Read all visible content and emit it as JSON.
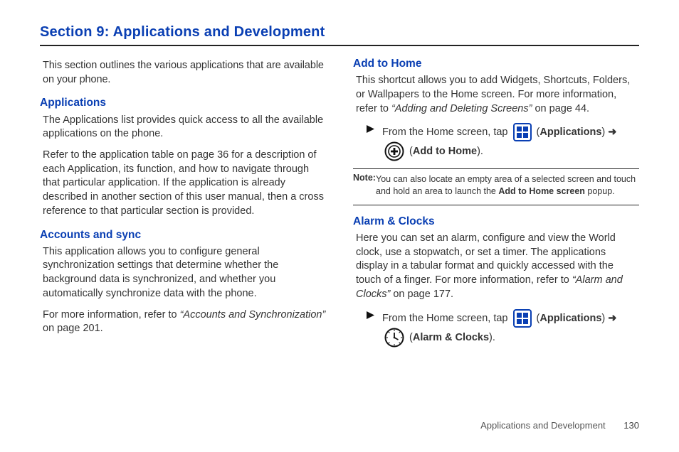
{
  "title": "Section 9: Applications and Development",
  "left": {
    "intro": "This section outlines the various applications that are available on your phone.",
    "h_applications": "Applications",
    "applications_p1": "The Applications list provides quick access to all the available applications on the phone.",
    "applications_p2": "Refer to the application table on page 36 for a description of each Application, its function, and how to navigate through that particular application. If the application is already described in another section of this user manual, then a cross reference to that particular section is provided.",
    "h_accounts": "Accounts and sync",
    "accounts_p1": "This application allows you to configure general synchronization settings that determine whether the background data is synchronized, and whether you automatically synchronize data with the phone.",
    "accounts_p2a": "For more information, refer to ",
    "accounts_p2b": "“Accounts and Synchronization”",
    "accounts_p2c": " on page 201."
  },
  "right": {
    "h_addhome": "Add to Home",
    "addhome_p1a": "This shortcut allows you to add Widgets, Shortcuts, Folders, or Wallpapers to the Home screen. For more information, refer to ",
    "addhome_p1b": "“Adding and Deleting Screens”",
    "addhome_p1c": "  on page 44.",
    "step1_a": "From the Home screen, tap ",
    "step1_apps": "Applications",
    "step1_arrow": " ➜ ",
    "step1_add": "Add to Home",
    "note_label": "Note:",
    "note_body_a": "You can also locate an empty area of a selected screen and touch and hold an area to launch the ",
    "note_body_b": "Add to Home screen",
    "note_body_c": " popup.",
    "h_alarm": "Alarm & Clocks",
    "alarm_p1a": "Here you can set an alarm, configure and view the World clock, use a stopwatch, or set a timer. The applications display in a tabular format and quickly accessed with the touch of a finger. For more information, refer to ",
    "alarm_p1b": "“Alarm and Clocks”",
    "alarm_p1c": "  on page 177.",
    "step2_a": "From the Home screen, tap ",
    "step2_apps": "Applications",
    "step2_arrow": " ➜ ",
    "step2_alarm": "Alarm & Clocks"
  },
  "footer": {
    "section": "Applications and Development",
    "page": "130"
  }
}
